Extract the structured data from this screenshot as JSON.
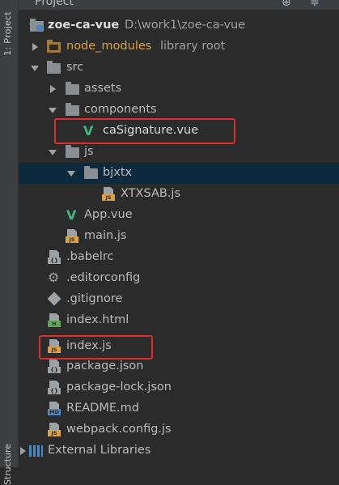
{
  "header": {
    "title": "Project"
  },
  "side": {
    "label": "1: Project",
    "bottom_label": "Structure"
  },
  "tree": [
    {
      "id": "root",
      "label": "zoe-ca-vue",
      "extra": "D:\\work1\\zoe-ca-vue"
    },
    {
      "id": "node_modules",
      "label": "node_modules",
      "extra": "library root"
    },
    {
      "id": "src",
      "label": "src"
    },
    {
      "id": "assets",
      "label": "assets"
    },
    {
      "id": "components",
      "label": "components"
    },
    {
      "id": "caSignature",
      "label": "caSignature.vue"
    },
    {
      "id": "js",
      "label": "js"
    },
    {
      "id": "bjxtx",
      "label": "bjxtx"
    },
    {
      "id": "XTXSAB",
      "label": "XTXSAB.js"
    },
    {
      "id": "App",
      "label": "App.vue"
    },
    {
      "id": "main",
      "label": "main.js"
    },
    {
      "id": "babelrc",
      "label": ".babelrc"
    },
    {
      "id": "editorconfig",
      "label": ".editorconfig"
    },
    {
      "id": "gitignore",
      "label": ".gitignore"
    },
    {
      "id": "index_html",
      "label": "index.html"
    },
    {
      "id": "index_js",
      "label": "index.js"
    },
    {
      "id": "package",
      "label": "package.json"
    },
    {
      "id": "package_lock",
      "label": "package-lock.json"
    },
    {
      "id": "readme",
      "label": "README.md"
    },
    {
      "id": "webpack",
      "label": "webpack.config.js"
    },
    {
      "id": "ext",
      "label": "External Libraries"
    }
  ],
  "icons": {
    "js_tag": "JS",
    "html_tag": "H",
    "md_tag": "MD",
    "json_tag": "{}"
  },
  "colors": {
    "accent_red": "#e02b2b",
    "selected_row": "#0d293e",
    "module_folder": "#d9a343"
  }
}
